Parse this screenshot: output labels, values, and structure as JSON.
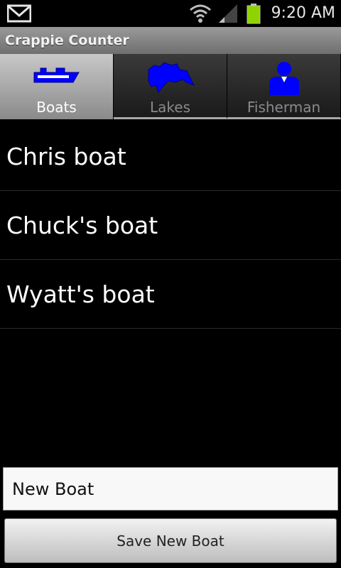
{
  "status_bar": {
    "time": "9:20 AM",
    "icons": [
      "gmail-icon",
      "wifi-icon",
      "signal-icon",
      "battery-icon"
    ],
    "battery_color": "#8fd400"
  },
  "app": {
    "title": "Crappie Counter"
  },
  "tabs": [
    {
      "label": "Boats",
      "icon": "boat-icon",
      "active": true
    },
    {
      "label": "Lakes",
      "icon": "lake-icon",
      "active": false
    },
    {
      "label": "Fisherman",
      "icon": "fisherman-icon",
      "active": false
    }
  ],
  "icon_color": "#0000ff",
  "boats": [
    {
      "name": "Chris boat"
    },
    {
      "name": "Chuck's boat"
    },
    {
      "name": "Wyatt's boat"
    }
  ],
  "form": {
    "input_value": "New Boat",
    "save_label": "Save New Boat"
  }
}
